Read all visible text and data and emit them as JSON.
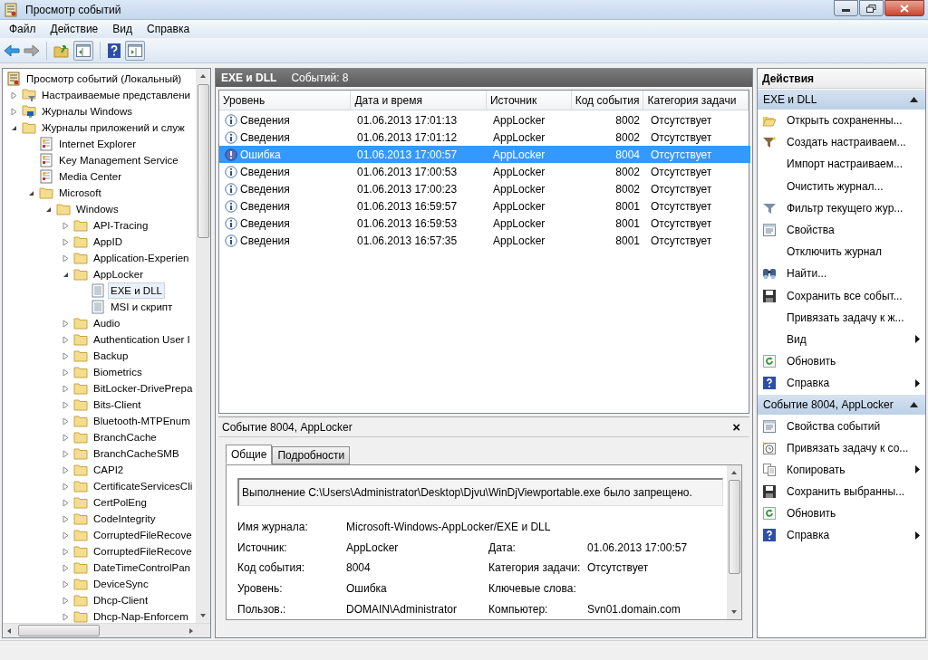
{
  "window": {
    "title": "Просмотр событий"
  },
  "menu": [
    "Файл",
    "Действие",
    "Вид",
    "Справка"
  ],
  "toolbar": [
    {
      "kind": "back"
    },
    {
      "kind": "forward"
    },
    {
      "kind": "sep"
    },
    {
      "kind": "up"
    },
    {
      "kind": "tree"
    },
    {
      "kind": "sep"
    },
    {
      "kind": "help"
    },
    {
      "kind": "pane"
    }
  ],
  "tree": {
    "label": "Просмотр событий (Локальный)",
    "kind": "root",
    "selected": false,
    "children": [
      {
        "label": "Настраиваемые представлени",
        "kind": "folder-filter",
        "expanded": false,
        "selected": false
      },
      {
        "label": "Журналы Windows",
        "kind": "folder-windows",
        "expanded": false,
        "selected": false
      },
      {
        "label": "Журналы приложений и служ",
        "kind": "folder-open",
        "expanded": true,
        "selected": false,
        "children": [
          {
            "label": "Internet Explorer",
            "kind": "event-log",
            "selected": false
          },
          {
            "label": "Key Management Service",
            "kind": "event-log",
            "selected": false
          },
          {
            "label": "Media Center",
            "kind": "event-log",
            "selected": false
          },
          {
            "label": "Microsoft",
            "kind": "folder",
            "expanded": true,
            "selected": false,
            "children": [
              {
                "label": "Windows",
                "kind": "folder",
                "expanded": true,
                "selected": false,
                "children": [
                  {
                    "label": "API-Tracing",
                    "kind": "folder",
                    "expanded": false,
                    "selected": false
                  },
                  {
                    "label": "AppID",
                    "kind": "folder",
                    "expanded": false,
                    "selected": false
                  },
                  {
                    "label": "Application-Experien",
                    "kind": "folder",
                    "expanded": false,
                    "selected": false
                  },
                  {
                    "label": "AppLocker",
                    "kind": "folder",
                    "expanded": true,
                    "selected": false,
                    "children": [
                      {
                        "label": "EXE и DLL",
                        "kind": "log",
                        "selected": true
                      },
                      {
                        "label": "MSI и скрипт",
                        "kind": "log",
                        "selected": false
                      }
                    ]
                  },
                  {
                    "label": "Audio",
                    "kind": "folder",
                    "expanded": false,
                    "selected": false
                  },
                  {
                    "label": "Authentication User I",
                    "kind": "folder",
                    "expanded": false,
                    "selected": false
                  },
                  {
                    "label": "Backup",
                    "kind": "folder",
                    "expanded": false,
                    "selected": false
                  },
                  {
                    "label": "Biometrics",
                    "kind": "folder",
                    "expanded": false,
                    "selected": false
                  },
                  {
                    "label": "BitLocker-DrivePrepa",
                    "kind": "folder",
                    "expanded": false,
                    "selected": false
                  },
                  {
                    "label": "Bits-Client",
                    "kind": "folder",
                    "expanded": false,
                    "selected": false
                  },
                  {
                    "label": "Bluetooth-MTPEnum",
                    "kind": "folder",
                    "expanded": false,
                    "selected": false
                  },
                  {
                    "label": "BranchCache",
                    "kind": "folder",
                    "expanded": false,
                    "selected": false
                  },
                  {
                    "label": "BranchCacheSMB",
                    "kind": "folder",
                    "expanded": false,
                    "selected": false
                  },
                  {
                    "label": "CAPI2",
                    "kind": "folder",
                    "expanded": false,
                    "selected": false
                  },
                  {
                    "label": "CertificateServicesCli",
                    "kind": "folder",
                    "expanded": false,
                    "selected": false
                  },
                  {
                    "label": "CertPolEng",
                    "kind": "folder",
                    "expanded": false,
                    "selected": false
                  },
                  {
                    "label": "CodeIntegrity",
                    "kind": "folder",
                    "expanded": false,
                    "selected": false
                  },
                  {
                    "label": "CorruptedFileRecove",
                    "kind": "folder",
                    "expanded": false,
                    "selected": false
                  },
                  {
                    "label": "CorruptedFileRecove",
                    "kind": "folder",
                    "expanded": false,
                    "selected": false
                  },
                  {
                    "label": "DateTimeControlPan",
                    "kind": "folder",
                    "expanded": false,
                    "selected": false
                  },
                  {
                    "label": "DeviceSync",
                    "kind": "folder",
                    "expanded": false,
                    "selected": false
                  },
                  {
                    "label": "Dhcp-Client",
                    "kind": "folder",
                    "expanded": false,
                    "selected": false
                  },
                  {
                    "label": "Dhcp-Nap-Enforcem",
                    "kind": "folder",
                    "expanded": false,
                    "selected": false
                  }
                ]
              }
            ]
          }
        ]
      }
    ]
  },
  "log_header": {
    "title": "EXE и DLL",
    "count": "Событий: 8"
  },
  "table": {
    "columns": [
      "Уровень",
      "Дата и время",
      "Источник",
      "Код события",
      "Категория задачи"
    ],
    "rows": [
      {
        "kind": "info",
        "level": "Сведения",
        "date": "01.06.2013 17:01:13",
        "source": "AppLocker",
        "code": "8002",
        "category": "Отсутствует",
        "selected": false
      },
      {
        "kind": "info",
        "level": "Сведения",
        "date": "01.06.2013 17:01:12",
        "source": "AppLocker",
        "code": "8002",
        "category": "Отсутствует",
        "selected": false
      },
      {
        "kind": "error",
        "level": "Ошибка",
        "date": "01.06.2013 17:00:57",
        "source": "AppLocker",
        "code": "8004",
        "category": "Отсутствует",
        "selected": true
      },
      {
        "kind": "info",
        "level": "Сведения",
        "date": "01.06.2013 17:00:53",
        "source": "AppLocker",
        "code": "8002",
        "category": "Отсутствует",
        "selected": false
      },
      {
        "kind": "info",
        "level": "Сведения",
        "date": "01.06.2013 17:00:23",
        "source": "AppLocker",
        "code": "8002",
        "category": "Отсутствует",
        "selected": false
      },
      {
        "kind": "info",
        "level": "Сведения",
        "date": "01.06.2013 16:59:57",
        "source": "AppLocker",
        "code": "8001",
        "category": "Отсутствует",
        "selected": false
      },
      {
        "kind": "info",
        "level": "Сведения",
        "date": "01.06.2013 16:59:53",
        "source": "AppLocker",
        "code": "8001",
        "category": "Отсутствует",
        "selected": false
      },
      {
        "kind": "info",
        "level": "Сведения",
        "date": "01.06.2013 16:57:35",
        "source": "AppLocker",
        "code": "8001",
        "category": "Отсутствует",
        "selected": false
      }
    ]
  },
  "details": {
    "title": "Событие 8004, AppLocker",
    "close": "×",
    "tabs": [
      {
        "label": "Общие",
        "selected": true
      },
      {
        "label": "Подробности",
        "selected": false
      }
    ],
    "message": "Выполнение C:\\Users\\Administrator\\Desktop\\Djvu\\WinDjViewportable.exe было запрещено.",
    "log_name": {
      "label": "Имя журнала:",
      "value": "Microsoft-Windows-AppLocker/EXE и DLL"
    },
    "fields": [
      {
        "label": "Источник:",
        "value": "AppLocker",
        "label2": "Дата:",
        "value2": "01.06.2013 17:00:57"
      },
      {
        "label": "Код события:",
        "value": "8004",
        "label2": "Категория задачи:",
        "value2": "Отсутствует"
      },
      {
        "label": "Уровень:",
        "value": "Ошибка",
        "label2": "Ключевые слова:"
      },
      {
        "label": "Пользов.:",
        "value": "DOMAIN\\Administrator",
        "label2": "Компьютер:",
        "value2": "Svn01.domain.com"
      }
    ]
  },
  "actions": {
    "title": "Действия",
    "sections": [
      {
        "title": "EXE и DLL",
        "expanded": true,
        "items": [
          {
            "label": "Открыть сохраненны...",
            "kind": "open",
            "submenu": false
          },
          {
            "label": "Создать настраиваем...",
            "kind": "filter-new",
            "submenu": false
          },
          {
            "label": "Импорт настраиваем...",
            "kind": "none",
            "submenu": false
          },
          {
            "label": "Очистить журнал...",
            "kind": "none",
            "submenu": false
          },
          {
            "label": "Фильтр текущего жур...",
            "kind": "filter",
            "submenu": false
          },
          {
            "label": "Свойства",
            "kind": "properties",
            "submenu": false
          },
          {
            "label": "Отключить журнал",
            "kind": "none",
            "submenu": false
          },
          {
            "label": "Найти...",
            "kind": "find",
            "submenu": false
          },
          {
            "label": "Сохранить все событ...",
            "kind": "save",
            "submenu": false
          },
          {
            "label": "Привязать задачу к ж...",
            "kind": "none",
            "submenu": false
          },
          {
            "label": "Вид",
            "kind": "none",
            "submenu": true
          },
          {
            "label": "Обновить",
            "kind": "refresh",
            "submenu": false
          },
          {
            "label": "Справка",
            "kind": "help",
            "submenu": true
          }
        ]
      },
      {
        "title": "Событие 8004, AppLocker",
        "expanded": true,
        "items": [
          {
            "label": "Свойства событий",
            "kind": "properties",
            "submenu": false
          },
          {
            "label": "Привязать задачу к со...",
            "kind": "task",
            "submenu": false
          },
          {
            "label": "Копировать",
            "kind": "copy",
            "submenu": true
          },
          {
            "label": "Сохранить выбранны...",
            "kind": "save",
            "submenu": false
          },
          {
            "label": "Обновить",
            "kind": "refresh",
            "submenu": false
          },
          {
            "label": "Справка",
            "kind": "help",
            "submenu": true
          }
        ]
      }
    ]
  }
}
